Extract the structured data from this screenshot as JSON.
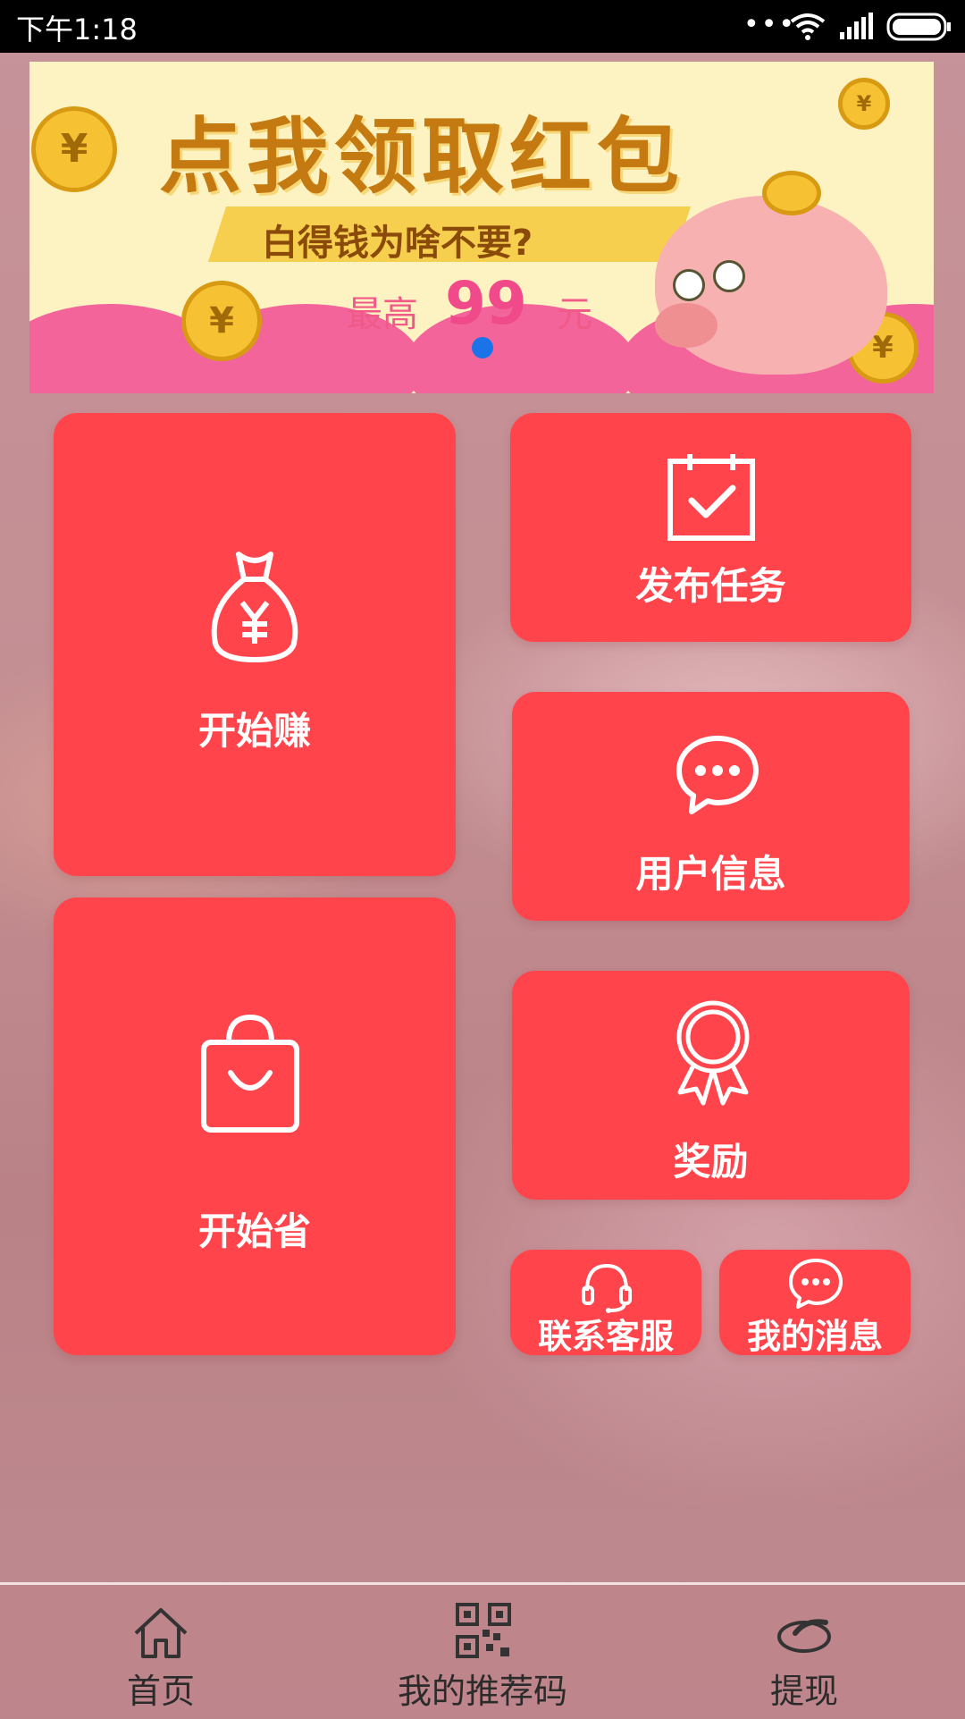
{
  "status_bar": {
    "time": "下午1:18",
    "dots": "•••"
  },
  "banner": {
    "title": "点我领取红包",
    "subtitle": "白得钱为啥不要?",
    "max_label": "最高",
    "max_value": "99",
    "unit": "元",
    "coin_symbol": "¥"
  },
  "tiles": {
    "start_earn": "开始赚",
    "publish_task": "发布任务",
    "user_info": "用户信息",
    "start_save": "开始省",
    "reward": "奖励",
    "contact_service": "联系客服",
    "my_messages": "我的消息"
  },
  "bottom_nav": [
    {
      "label": "首页",
      "icon": "home-icon"
    },
    {
      "label": "我的推荐码",
      "icon": "qr-code-icon"
    },
    {
      "label": "提现",
      "icon": "withdraw-icon"
    }
  ],
  "colors": {
    "tile": "#ff454b",
    "indicator": "#1a73e8",
    "banner_bg": "#fdf3c2"
  }
}
